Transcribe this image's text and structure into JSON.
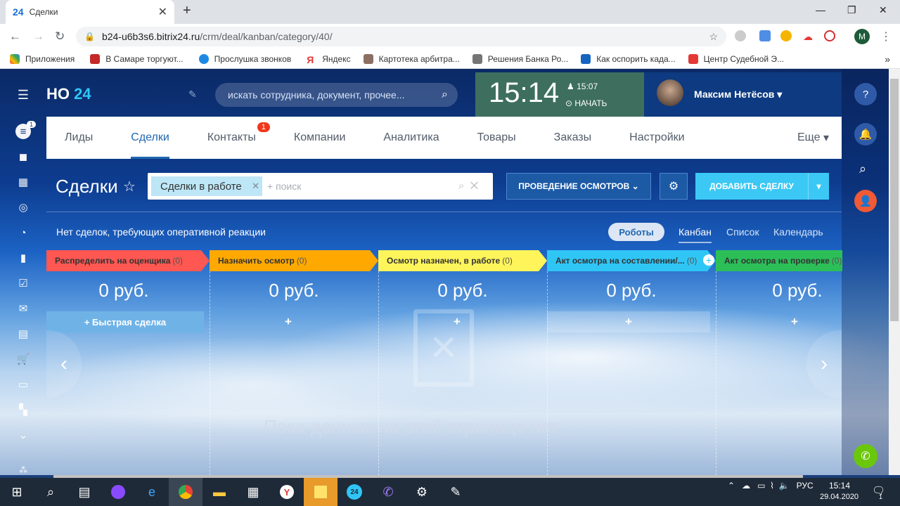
{
  "browser": {
    "tab_title": "Сделки",
    "tab_icon": "24",
    "url_host": "b24-u6b3s6.bitrix24.ru",
    "url_path": "/crm/deal/kanban/category/40/",
    "profile_initial": "M",
    "bookmarks": [
      "Приложения",
      "В Самаре торгуют...",
      "Прослушка звонков",
      "Яндекс",
      "Картотека арбитра...",
      "Решения Банка Ро...",
      "Как оспорить када...",
      "Центр Судебной Э..."
    ]
  },
  "header": {
    "logo_text": "НО",
    "logo_num": "24",
    "search_placeholder": "искать сотрудника, документ, прочее...",
    "clock": "15:14",
    "alarm": "15:07",
    "start_label": "НАЧАТЬ",
    "user_name": "Максим Нетёсов"
  },
  "sidebar": {
    "badge": "1"
  },
  "menu": {
    "items": [
      "Лиды",
      "Сделки",
      "Контакты",
      "Компании",
      "Аналитика",
      "Товары",
      "Заказы",
      "Настройки"
    ],
    "contacts_badge": "1",
    "more": "Еще"
  },
  "toolbar": {
    "title": "Сделки",
    "filter_chip": "Сделки в работе",
    "search_placeholder": "+ поиск",
    "pipeline_button": "ПРОВЕДЕНИЕ ОСМОТРОВ",
    "add_button": "ДОБАВИТЬ СДЕЛКУ"
  },
  "subbar": {
    "notice": "Нет сделок, требующих оперативной реакции",
    "robots": "Роботы",
    "views": [
      "Канбан",
      "Список",
      "Календарь"
    ]
  },
  "stages": [
    {
      "name": "Распределить на оценщика",
      "count": "(0)",
      "color": "#ff5752",
      "sum": "0 руб."
    },
    {
      "name": "Назначить осмотр",
      "count": "(0)",
      "color": "#ffa900",
      "sum": "0 руб."
    },
    {
      "name": "Осмотр назначен, в работе",
      "count": "(0)",
      "color": "#fff55a",
      "sum": "0 руб."
    },
    {
      "name": "Акт осмотра на составлении/...",
      "count": "(0)",
      "color": "#2fc6f6",
      "sum": "0 руб."
    },
    {
      "name": "Акт осмотра на проверке",
      "count": "(0)",
      "color": "#2cbf58",
      "sum": "0 руб."
    }
  ],
  "kanban": {
    "quick_deal": "Быстрая сделка",
    "empty_text": "Пока данных на этой странице нет"
  },
  "taskbar": {
    "lang": "РУС",
    "time": "15:14",
    "date": "29.04.2020",
    "notif_count": "1"
  }
}
